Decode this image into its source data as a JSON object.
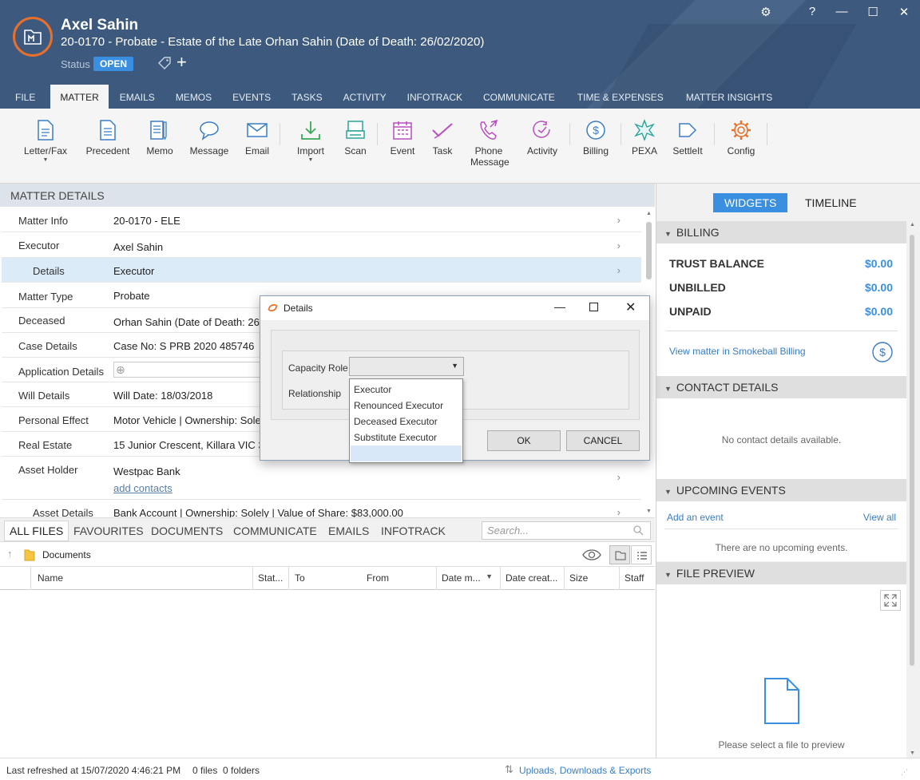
{
  "header": {
    "client_name": "Axel Sahin",
    "matter_title": "20-0170 - Probate - Estate of the Late Orhan Sahin (Date of Death: 26/02/2020)",
    "status_label": "Status",
    "status_value": "OPEN",
    "window_controls": [
      "⚙",
      "?",
      "—",
      "☐",
      "✕"
    ]
  },
  "nav": {
    "tabs": [
      "FILE",
      "MATTER",
      "EMAILS",
      "MEMOS",
      "EVENTS",
      "TASKS",
      "ACTIVITY",
      "INFOTRACK",
      "COMMUNICATE",
      "TIME & EXPENSES",
      "MATTER INSIGHTS"
    ],
    "active": "MATTER"
  },
  "ribbon": {
    "letter_fax": "Letter/Fax",
    "precedent": "Precedent",
    "memo": "Memo",
    "message": "Message",
    "email": "Email",
    "import": "Import",
    "scan": "Scan",
    "event": "Event",
    "task": "Task",
    "phone_message_1": "Phone",
    "phone_message_2": "Message",
    "activity": "Activity",
    "billing": "Billing",
    "pexa": "PEXA",
    "settleit": "SettleIt",
    "config": "Config"
  },
  "matter_details": {
    "header": "MATTER DETAILS",
    "rows": [
      {
        "label": "Matter Info",
        "value": "20-0170 - ELE"
      },
      {
        "label": "Executor",
        "value": "Axel Sahin"
      },
      {
        "label": "Details",
        "value": "Executor"
      },
      {
        "label": "Matter Type",
        "value": "Probate"
      },
      {
        "label": "Deceased",
        "value": "Orhan Sahin (Date of Death: 26/"
      },
      {
        "label": "Case Details",
        "value": "Case No: S PRB 2020 485746"
      },
      {
        "label": "Application Details",
        "value": ""
      },
      {
        "label": "Will Details",
        "value": "Will Date: 18/03/2018"
      },
      {
        "label": "Personal Effect",
        "value": "Motor Vehicle | Ownership: Solel"
      },
      {
        "label": "Real Estate",
        "value": "15 Junior Crescent, Killara VIC 33"
      },
      {
        "label": "Asset Holder",
        "value": "Westpac Bank"
      },
      {
        "label": "Asset Details",
        "value": "Bank Account | Ownership: Solely | Value of Share: $83,000.00"
      }
    ],
    "add_contacts": "add contacts"
  },
  "files": {
    "tabs": [
      "ALL FILES",
      "FAVOURITES",
      "DOCUMENTS",
      "COMMUNICATE",
      "EMAILS",
      "INFOTRACK"
    ],
    "search_placeholder": "Search...",
    "path": "Documents",
    "columns": [
      "Name",
      "Stat...",
      "To",
      "From",
      "Date m...",
      "Date creat...",
      "Size",
      "Staff"
    ]
  },
  "status_bar": {
    "last_refreshed": "Last refreshed at 15/07/2020 4:46:21 PM",
    "counts": "0 files  0 folders",
    "uploads_link": "Uploads, Downloads & Exports"
  },
  "right_panel": {
    "tabs": [
      "WIDGETS",
      "TIMELINE"
    ],
    "billing": {
      "title": "BILLING",
      "trust_label": "TRUST BALANCE",
      "trust_value": "$0.00",
      "unbilled_label": "UNBILLED",
      "unbilled_value": "$0.00",
      "unpaid_label": "UNPAID",
      "unpaid_value": "$0.00",
      "link": "View matter in Smokeball Billing"
    },
    "contact": {
      "title": "CONTACT DETAILS",
      "empty": "No contact details available."
    },
    "events": {
      "title": "UPCOMING EVENTS",
      "add": "Add an event",
      "view_all": "View all",
      "empty": "There are no upcoming events."
    },
    "preview": {
      "title": "FILE PREVIEW",
      "empty": "Please select a file to preview"
    }
  },
  "dialog": {
    "title": "Details",
    "capacity_role_label": "Capacity Role",
    "relationship_label": "Relationship",
    "options": [
      "Executor",
      "Renounced Executor",
      "Deceased Executor",
      "Substitute Executor",
      ""
    ],
    "ok": "OK",
    "cancel": "CANCEL"
  },
  "colors": {
    "header_bg": "#3d5a7e",
    "accent": "#3b8fe0",
    "brand_orange": "#e8702a"
  }
}
